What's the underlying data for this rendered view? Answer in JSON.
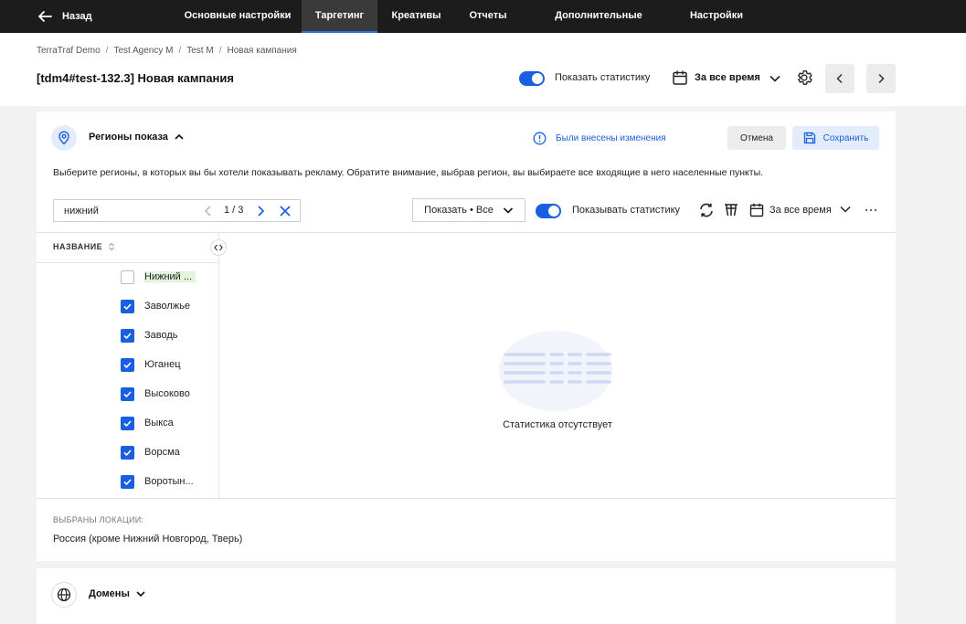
{
  "nav": {
    "back_label": "Назад",
    "tabs": [
      {
        "label": "Основные настройки"
      },
      {
        "label": "Таргетинг"
      },
      {
        "label": "Креативы"
      },
      {
        "label": "Отчеты"
      },
      {
        "label": "Дополнительные настройки"
      },
      {
        "label": "Настройки"
      }
    ],
    "active_tab": "Таргетинг"
  },
  "breadcrumb": [
    "TerraTraf Demo",
    "Test Agency M",
    "Test M",
    "Новая кампания"
  ],
  "header": {
    "title": "[tdm4#test-132.3] Новая кампания",
    "show_stats_label": "Показать статистику",
    "show_stats_on": true,
    "period": "За все время"
  },
  "regions": {
    "title": "Регионы показа",
    "changes_notice": "Были внесены изменения",
    "cancel_label": "Отмена",
    "save_label": "Сохранить",
    "description": "Выберите регионы, в которых вы бы хотели показывать рекламу. Обратите внимание, выбрав регион, вы выбираете все входящие в него населенные пункты.",
    "search": {
      "value": "нижний",
      "counter": "1 / 3"
    },
    "show_filter": "Показать • Все",
    "show_stats_label": "Показывать статистику",
    "show_stats_on": true,
    "period": "За все время",
    "column_header": "НАЗВАНИЕ",
    "items": [
      {
        "label": "Нижний ...",
        "checked": false,
        "highlight": true
      },
      {
        "label": "Заволжье",
        "checked": true,
        "highlight": false
      },
      {
        "label": "Заводь",
        "checked": true,
        "highlight": false
      },
      {
        "label": "Юганец",
        "checked": true,
        "highlight": false
      },
      {
        "label": "Высоково",
        "checked": true,
        "highlight": false
      },
      {
        "label": "Выкса",
        "checked": true,
        "highlight": false
      },
      {
        "label": "Ворсма",
        "checked": true,
        "highlight": false
      },
      {
        "label": "Воротын...",
        "checked": true,
        "highlight": false
      }
    ],
    "empty_text": "Статистика отсутствует",
    "selected_title": "ВЫБРАНЫ ЛОКАЦИИ:",
    "selected_value": "Россия (кроме Нижний Новгород, Тверь)"
  },
  "domains": {
    "title": "Домены"
  },
  "colors": {
    "accent": "#1a5fe0",
    "topbar": "#1c1c1c",
    "highlight": "#e2f5dc"
  }
}
